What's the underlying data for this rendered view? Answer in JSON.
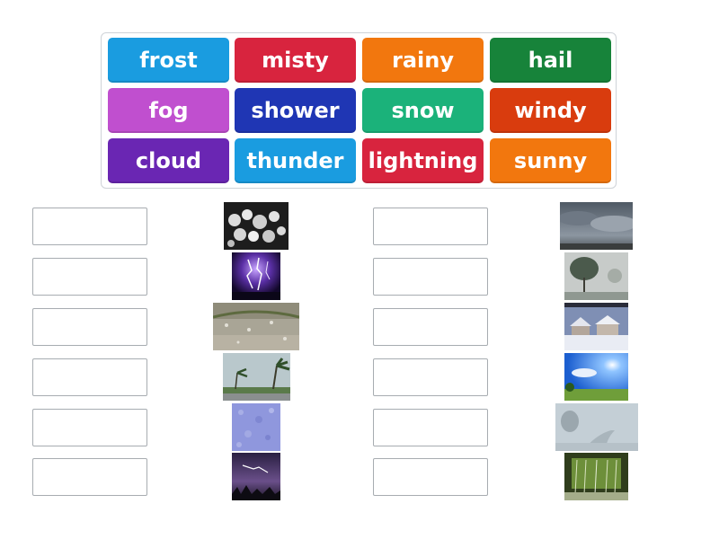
{
  "tiles": [
    {
      "label": "frost",
      "color": "#1a9ce0"
    },
    {
      "label": "misty",
      "color": "#d8243e"
    },
    {
      "label": "rainy",
      "color": "#f2770e"
    },
    {
      "label": "hail",
      "color": "#17833a"
    },
    {
      "label": "fog",
      "color": "#c04fcf"
    },
    {
      "label": "shower",
      "color": "#1f36b4"
    },
    {
      "label": "snow",
      "color": "#1bb27a"
    },
    {
      "label": "windy",
      "color": "#d93c0e"
    },
    {
      "label": "cloud",
      "color": "#6a26b3"
    },
    {
      "label": "thunder",
      "color": "#1a9ce0"
    },
    {
      "label": "lightning",
      "color": "#d8243e"
    },
    {
      "label": "sunny",
      "color": "#f2770e"
    }
  ],
  "images": [
    {
      "name": "hailstones-image"
    },
    {
      "name": "lightning-bolts-image"
    },
    {
      "name": "rain-on-window-image"
    },
    {
      "name": "windy-palms-image"
    },
    {
      "name": "frost-texture-image"
    },
    {
      "name": "thunderstorm-image"
    },
    {
      "name": "cloudy-sky-image"
    },
    {
      "name": "misty-trees-image"
    },
    {
      "name": "snowy-houses-image"
    },
    {
      "name": "sunny-field-image"
    },
    {
      "name": "foggy-road-image"
    },
    {
      "name": "shower-rain-image"
    }
  ]
}
